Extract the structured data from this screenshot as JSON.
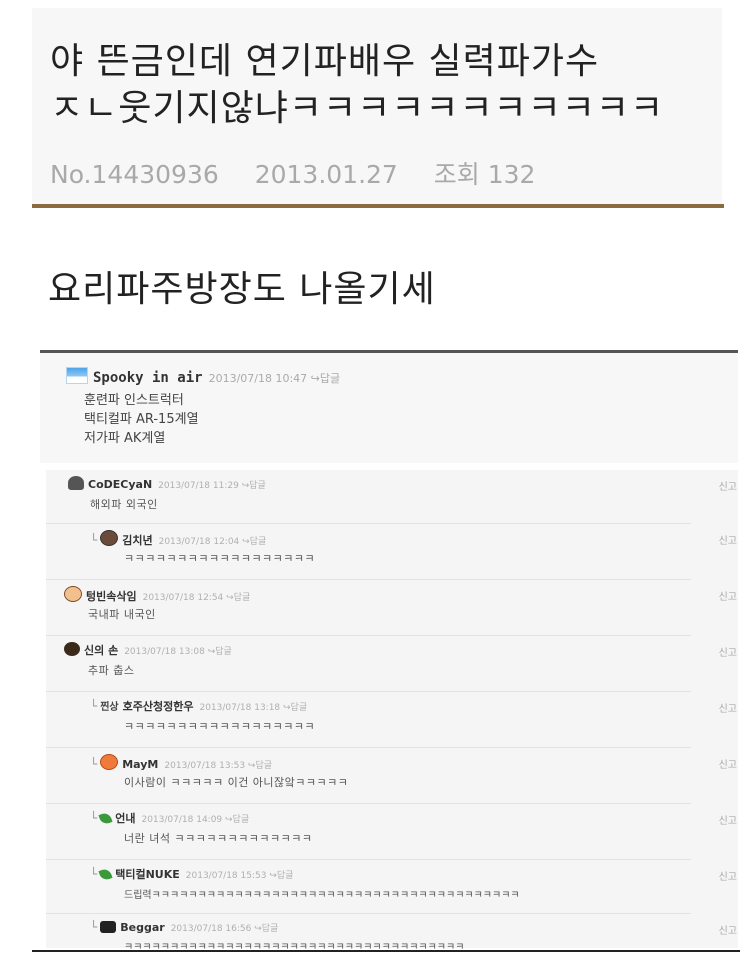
{
  "post": {
    "title_line1": "야 뜬금인데 연기파배우 실력파가수",
    "title_line2": "ㅈㄴ웃기지않냐ㅋㅋㅋㅋㅋㅋㅋㅋㅋㅋㅋ",
    "number": "No.14430936",
    "date": "2013.01.27",
    "views": "조회 132",
    "body": "요리파주방장도 나올기세"
  },
  "first_comment": {
    "nickname": "Spooky in air",
    "meta": "2013/07/18 10:47 ↪답글",
    "lines": [
      "훈련파 인스트럭터",
      "택티컬파 AR-15계열",
      "저가파 AK계열"
    ]
  },
  "report_label": "신고",
  "comments": [
    {
      "nickname": "CoDECyaN",
      "meta": "2013/07/18 11:29 ↪답글",
      "text": "해외파 외국인",
      "reply": false,
      "avatar": "cap-icon"
    },
    {
      "nickname": "김치년",
      "meta": "2013/07/18 12:04 ↪답글",
      "text": "ㅋㅋㅋㅋㅋㅋㅋㅋㅋㅋㅋㅋㅋㅋㅋㅋㅋㅋ",
      "reply": true,
      "avatar": "face-icon"
    },
    {
      "nickname": "텅빈속삭임",
      "meta": "2013/07/18 12:54 ↪답글",
      "text": "국내파 내국인",
      "reply": false,
      "avatar": "smile-icon"
    },
    {
      "nickname": "신의 손",
      "meta": "2013/07/18 13:08 ↪답글",
      "text": "추파 춥스",
      "reply": false,
      "avatar": "curly-hair-icon"
    },
    {
      "nickname": "호주산청정한우",
      "meta": "2013/07/18 13:18 ↪답글",
      "text": "ㅋㅋㅋㅋㅋㅋㅋㅋㅋㅋㅋㅋㅋㅋㅋㅋㅋㅋ",
      "reply": true,
      "avatar": "jjang-badge",
      "badge_text": "찐상"
    },
    {
      "nickname": "MayM",
      "meta": "2013/07/18 13:53 ↪답글",
      "text": "이사람이 ㅋㅋㅋㅋㅋ 이건 아니잖앜ㅋㅋㅋㅋㅋ",
      "reply": true,
      "avatar": "orange-face-icon"
    },
    {
      "nickname": "언내",
      "meta": "2013/07/18 14:09 ↪답글",
      "text": "너란 녀석 ㅋㅋㅋㅋㅋㅋㅋㅋㅋㅋㅋㅋㅋ",
      "reply": true,
      "avatar": "leaf-icon"
    },
    {
      "nickname": "택티컬NUKE",
      "meta": "2013/07/18 15:53 ↪답글",
      "text": "드립력ㅋㅋㅋㅋㅋㅋㅋㅋㅋㅋㅋㅋㅋㅋㅋㅋㅋㅋㅋㅋㅋㅋㅋㅋㅋㅋㅋㅋㅋㅋㅋㅋㅋㅋㅋㅋㅋㅋㅋㅋ",
      "reply": true,
      "avatar": "leaf-icon"
    },
    {
      "nickname": "Beggar",
      "meta": "2013/07/18 16:56 ↪답글",
      "text": "ㅋㅋㅋㅋㅋㅋㅋㅋㅋㅋㅋㅋㅋㅋㅋㅋㅋㅋㅋㅋㅋㅋㅋㅋㅋㅋㅋㅋㅋㅋㅋㅋㅋㅋㅋㅋㅋ",
      "reply": true,
      "avatar": "chat-bubble-icon"
    }
  ]
}
